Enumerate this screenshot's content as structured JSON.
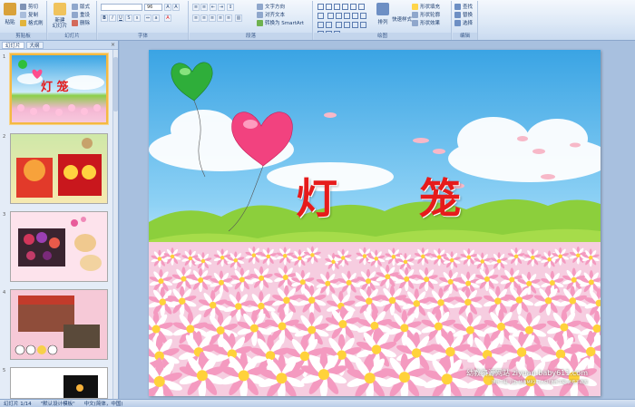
{
  "ribbon": {
    "clipboard": {
      "label": "剪贴板",
      "paste": "粘贴",
      "cut": "剪切",
      "copy": "复制",
      "format_painter": "格式刷"
    },
    "slides": {
      "label": "幻灯片",
      "new_slide": "新建\n幻灯片",
      "layout": "版式",
      "reset": "重设",
      "delete": "删除"
    },
    "font": {
      "label": "字体",
      "font_size": "96"
    },
    "paragraph": {
      "label": "段落",
      "text_direction": "文字方向",
      "align_text": "对齐文本",
      "smartart": "转换为 SmartArt"
    },
    "drawing": {
      "label": "绘图",
      "arrange": "排列",
      "quick_styles": "快速样式",
      "shape_fill": "形状填充",
      "shape_outline": "形状轮廓",
      "shape_effects": "形状效果"
    },
    "editing": {
      "label": "编辑",
      "find": "查找",
      "replace": "替换",
      "select": "选择"
    }
  },
  "panel": {
    "tab_slides": "幻灯片",
    "tab_outline": "大纲",
    "close": "×",
    "thumbs": [
      {
        "num": "1",
        "title": "灯 笼"
      },
      {
        "num": "2"
      },
      {
        "num": "3"
      },
      {
        "num": "4"
      },
      {
        "num": "5"
      }
    ]
  },
  "slide": {
    "title_char_1": "灯",
    "title_char_2": "笼",
    "site": "幼教资源网站 ziyuan.baby611.com",
    "site_sub": "课件下载  儿歌  故事MP3  FLASH课件下载  试卷下载库"
  },
  "status": {
    "slide_count": "幻灯片 1/14",
    "theme": "\"默认设计模板\"",
    "language": "中文(简体，中国)"
  },
  "colors": {
    "title_red": "#e61b1b",
    "ribbon_blue": "#dce8f6",
    "selection": "#f4b942"
  }
}
